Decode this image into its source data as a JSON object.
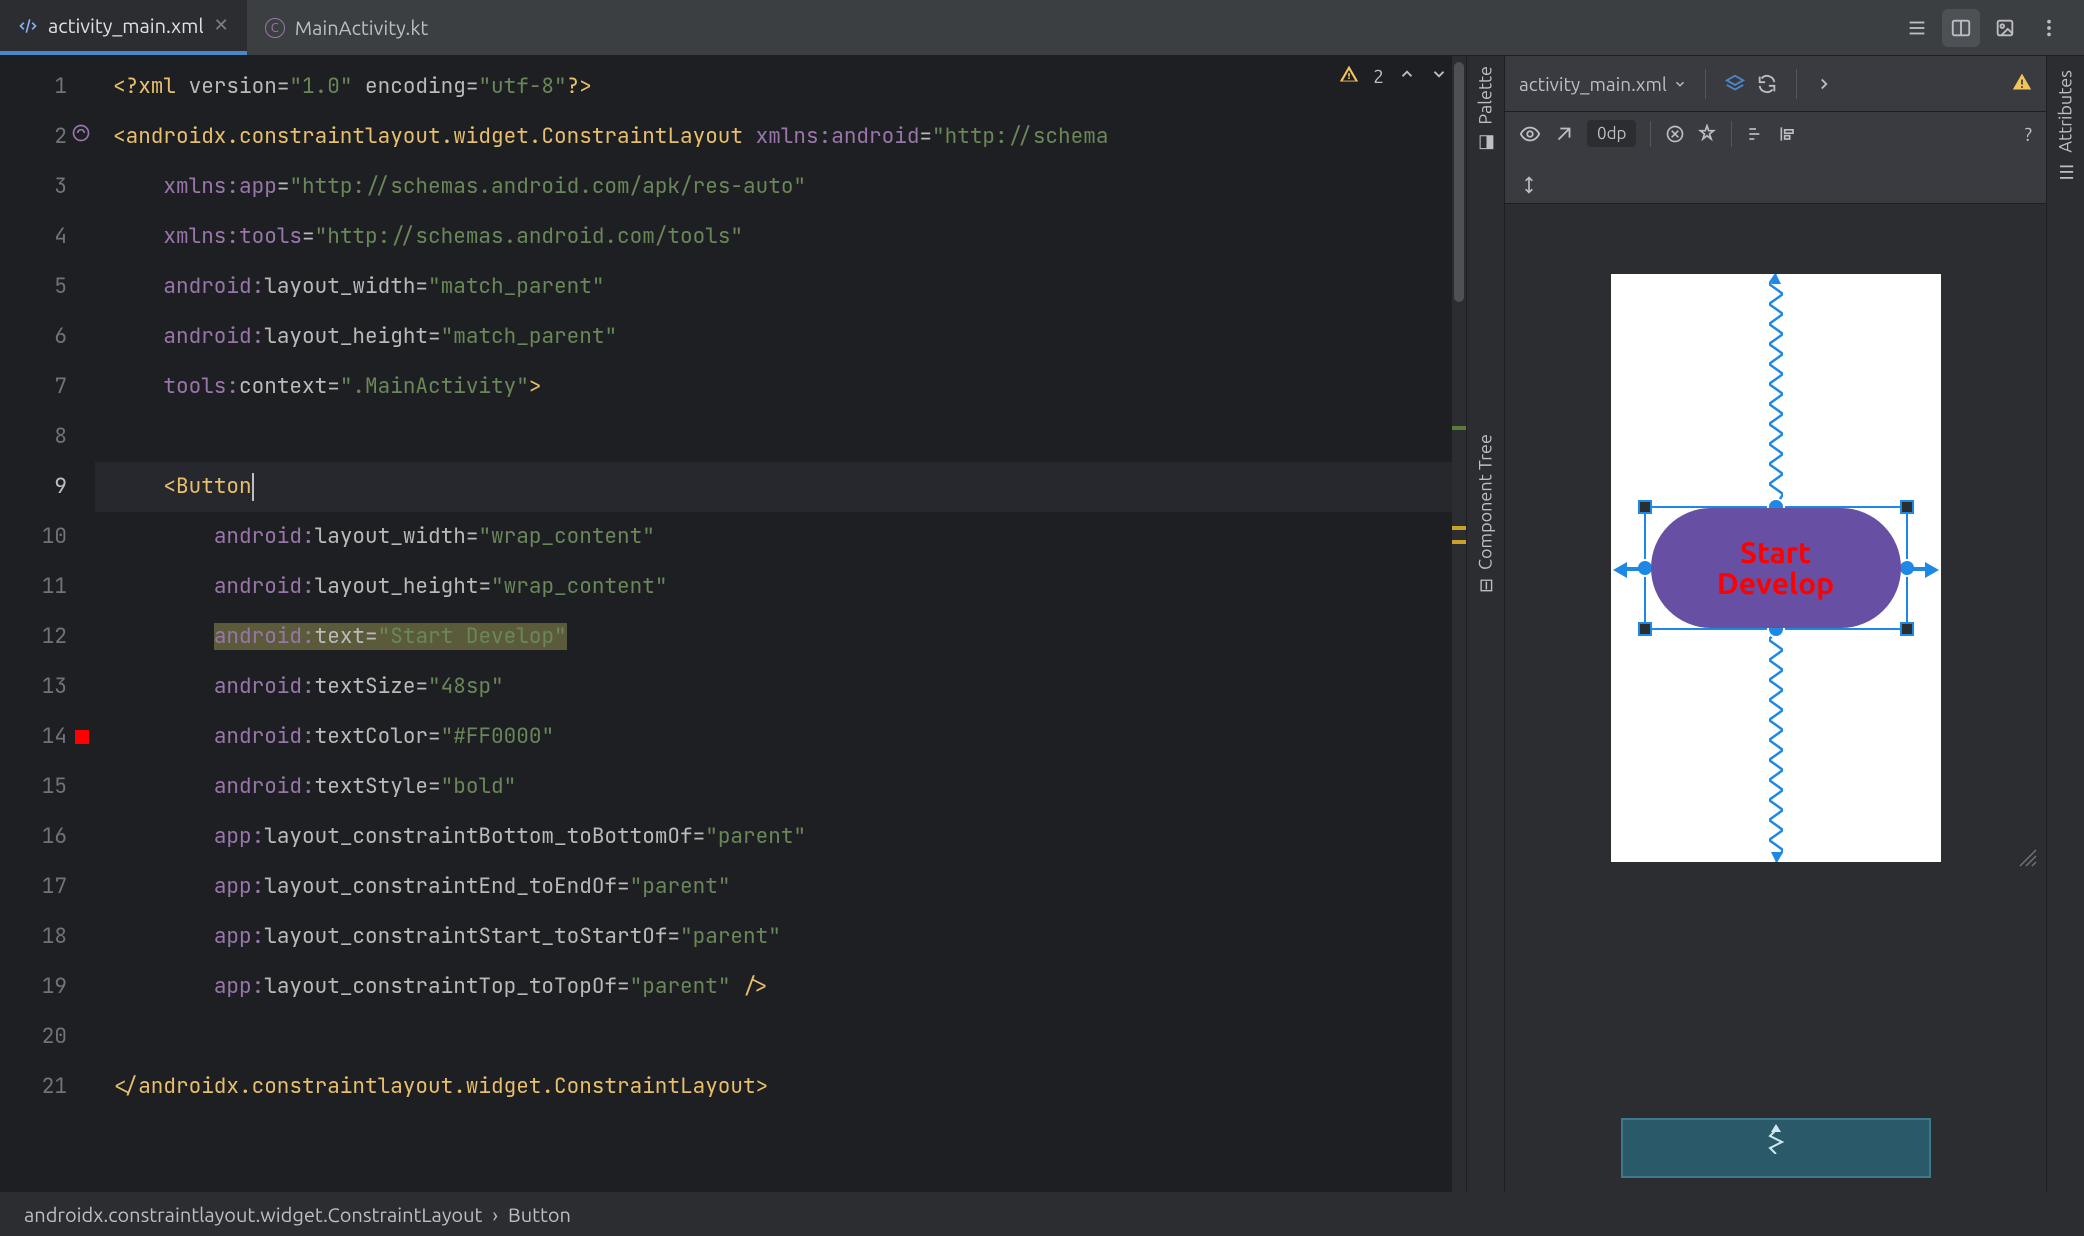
{
  "tabs": {
    "active": {
      "label": "activity_main.xml"
    },
    "inactive": {
      "label": "MainActivity.kt"
    }
  },
  "topright_tools": {
    "warnings": "2"
  },
  "code": {
    "lines": [
      {
        "n": "1"
      },
      {
        "n": "2"
      },
      {
        "n": "3"
      },
      {
        "n": "4"
      },
      {
        "n": "5"
      },
      {
        "n": "6"
      },
      {
        "n": "7"
      },
      {
        "n": "8"
      },
      {
        "n": "9"
      },
      {
        "n": "10"
      },
      {
        "n": "11"
      },
      {
        "n": "12"
      },
      {
        "n": "13"
      },
      {
        "n": "14"
      },
      {
        "n": "15"
      },
      {
        "n": "16"
      },
      {
        "n": "17"
      },
      {
        "n": "18"
      },
      {
        "n": "19"
      },
      {
        "n": "20"
      },
      {
        "n": "21"
      }
    ],
    "l1": {
      "pi_open": "<?",
      "pi_name": "xml ",
      "a1": "version",
      "v1": "\"1.0\"",
      "a2": " encoding",
      "v2": "\"utf-8\"",
      "pi_close": "?>"
    },
    "l2": {
      "open": "<",
      "tag": "androidx.constraintlayout.widget.ConstraintLayout ",
      "ns": "xmlns:",
      "a": "android",
      "v": "\"http://schema"
    },
    "l3": {
      "ns": "xmlns:",
      "a": "app",
      "v": "\"http://schemas.android.com/apk/res-auto\""
    },
    "l4": {
      "ns": "xmlns:",
      "a": "tools",
      "v": "\"http://schemas.android.com/tools\""
    },
    "l5": {
      "ns": "android:",
      "a": "layout_width",
      "v": "\"match_parent\""
    },
    "l6": {
      "ns": "android:",
      "a": "layout_height",
      "v": "\"match_parent\""
    },
    "l7": {
      "ns": "tools:",
      "a": "context",
      "v": "\".MainActivity\"",
      "close": ">"
    },
    "l9": {
      "open": "<",
      "tag": "Button"
    },
    "l10": {
      "ns": "android:",
      "a": "layout_width",
      "v": "\"wrap_content\""
    },
    "l11": {
      "ns": "android:",
      "a": "layout_height",
      "v": "\"wrap_content\""
    },
    "l12": {
      "ns": "android:",
      "a": "text",
      "v": "\"Start Develop\""
    },
    "l13": {
      "ns": "android:",
      "a": "textSize",
      "v": "\"48sp\""
    },
    "l14": {
      "ns": "android:",
      "a": "textColor",
      "v": "\"#FF0000\""
    },
    "l15": {
      "ns": "android:",
      "a": "textStyle",
      "v": "\"bold\""
    },
    "l16": {
      "ns": "app:",
      "a": "layout_constraintBottom_toBottomOf",
      "v": "\"parent\""
    },
    "l17": {
      "ns": "app:",
      "a": "layout_constraintEnd_toEndOf",
      "v": "\"parent\""
    },
    "l18": {
      "ns": "app:",
      "a": "layout_constraintStart_toStartOf",
      "v": "\"parent\""
    },
    "l19": {
      "ns": "app:",
      "a": "layout_constraintTop_toTopOf",
      "v": "\"parent\"",
      "close": " />"
    },
    "l21": {
      "open": "</",
      "tag": "androidx.constraintlayout.widget.ConstraintLayout",
      "close": ">"
    }
  },
  "breadcrumb": {
    "p1": "androidx.constraintlayout.widget.ConstraintLayout",
    "sep": "›",
    "p2": "Button"
  },
  "side": {
    "palette": "Palette",
    "tree": "Component Tree",
    "attrs": "Attributes"
  },
  "design": {
    "file": "activity_main.xml",
    "dp": "0dp",
    "button_text_1": "Start",
    "button_text_2": "Develop"
  }
}
